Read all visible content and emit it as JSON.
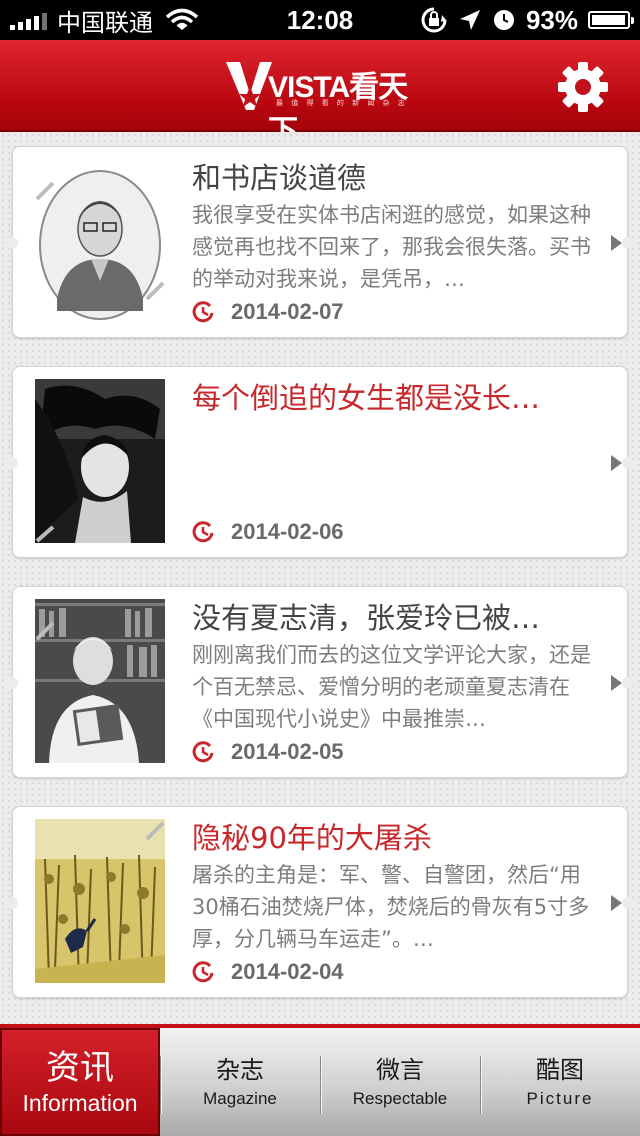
{
  "status_bar": {
    "carrier": "中国联通",
    "time": "12:08",
    "battery": "93%"
  },
  "header": {
    "logo_text": "VISTA看天下",
    "logo_slogan": "最 值 得 看 的 新 闻 杂 志",
    "settings_icon": "gear-icon"
  },
  "colors": {
    "accent_red": "#c41018",
    "highlight_title": "#c8282b",
    "normal_title": "#444444",
    "summary_text": "#7d7d7d"
  },
  "articles": [
    {
      "title": "和书店谈道德",
      "summary": "我很享受在实体书店闲逛的感觉，如果这种感觉再也找不回来了，那我会很失落。买书的举动对我来说，是凭吊，…",
      "date": "2014-02-07",
      "highlighted": false
    },
    {
      "title": "每个倒追的女生都是没长…",
      "summary": "",
      "date": "2014-02-06",
      "highlighted": true
    },
    {
      "title": "没有夏志清，张爱玲已被…",
      "summary": "刚刚离我们而去的这位文学评论大家，还是个百无禁忌、爱憎分明的老顽童夏志清在《中国现代小说史》中最推崇…",
      "date": "2014-02-05",
      "highlighted": false
    },
    {
      "title": "隐秘90年的大屠杀",
      "summary": "屠杀的主角是：军、警、自警团，然后“用30桶石油焚烧尸体，焚烧后的骨灰有5寸多厚，分几辆马车运走”。…",
      "date": "2014-02-04",
      "highlighted": true
    }
  ],
  "tabs": [
    {
      "zh": "资讯",
      "en": "Information",
      "active": true
    },
    {
      "zh": "杂志",
      "en": "Magazine",
      "active": false
    },
    {
      "zh": "微言",
      "en": "Respectable",
      "active": false
    },
    {
      "zh": "酷图",
      "en": "Picture",
      "active": false
    }
  ]
}
